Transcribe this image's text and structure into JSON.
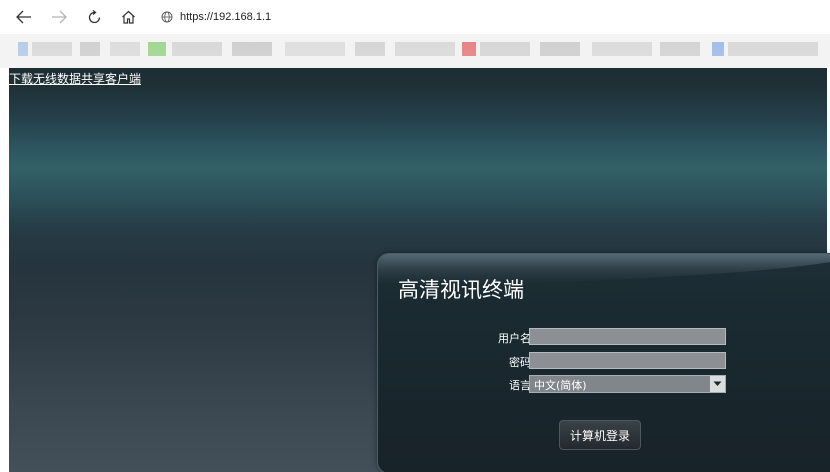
{
  "browser": {
    "url": "https://192.168.1.1",
    "back_icon": "arrow-left-icon",
    "forward_icon": "arrow-right-icon",
    "refresh_icon": "refresh-icon",
    "home_icon": "home-icon",
    "site_icon": "globe-icon"
  },
  "page": {
    "download_link": "下载无线数据共享客户端"
  },
  "login": {
    "title": "高清视讯终端",
    "username_label": "用户名",
    "username_value": "",
    "password_label": "密码",
    "password_value": "",
    "language_label": "语言",
    "language_value": "中文(简体)",
    "login_button": "计算机登录"
  },
  "colors": {
    "page_bg_top": "#1c2d33",
    "page_bg_band": "#326066",
    "page_bg_bottom": "#434f59",
    "panel_bg": "#1b2b32",
    "field_bg": "#8c9094"
  }
}
